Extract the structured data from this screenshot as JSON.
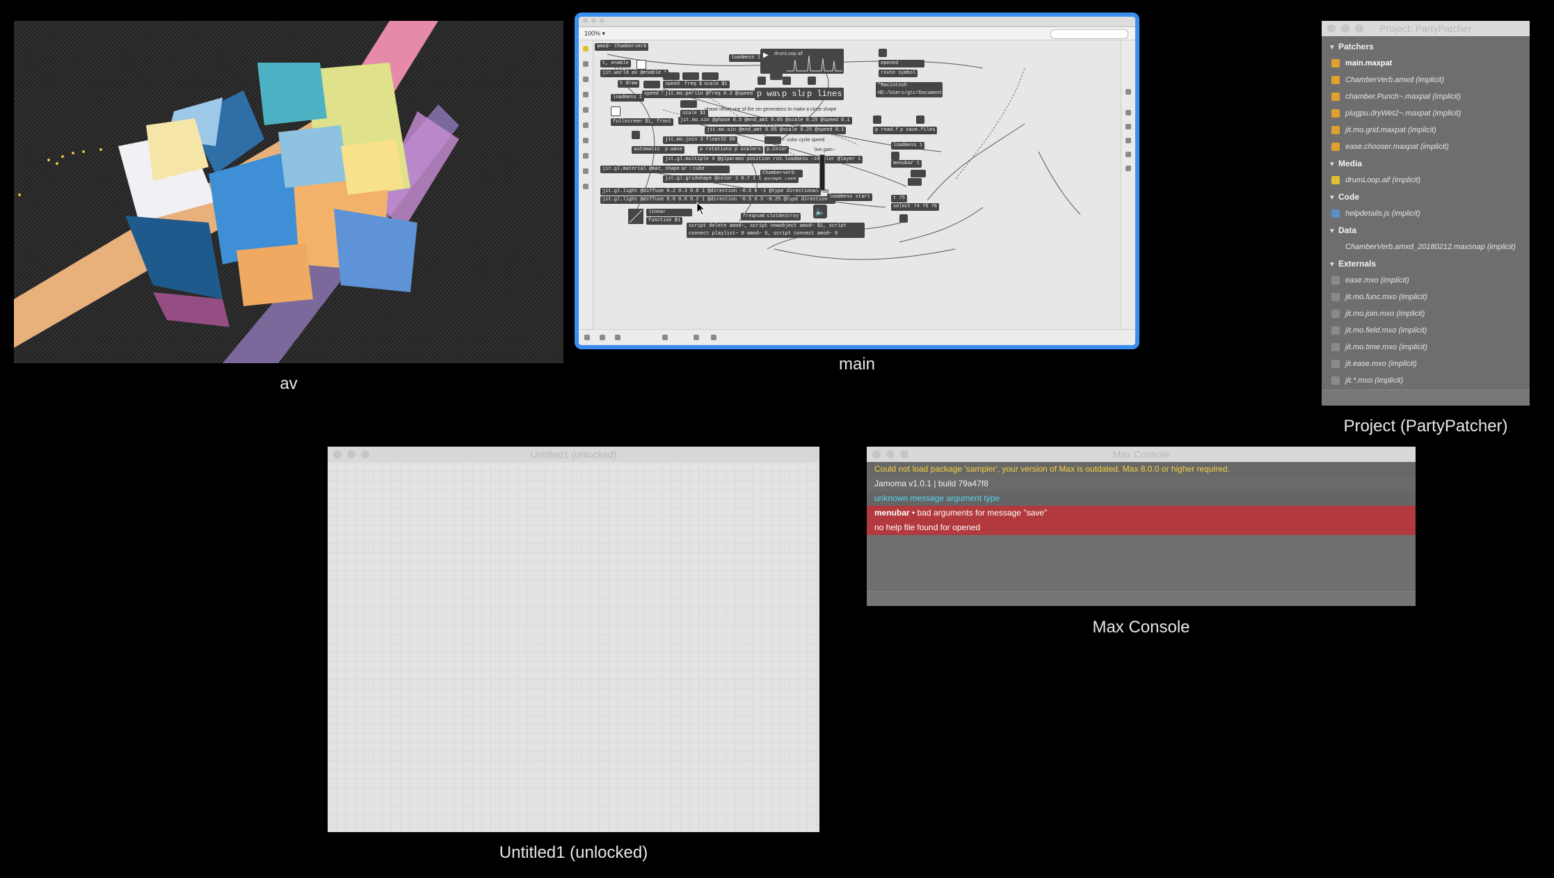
{
  "windows": {
    "av": {
      "caption": "av"
    },
    "main": {
      "caption": "main",
      "zoom": "100% ▾",
      "objects": {
        "amod": "amod~ Chamberverb",
        "enable": "t, enable",
        "toolbar_label": "loadmess 1",
        "drumloop": "drumLoop.aif",
        "jitworld": "jit.world av @enable 1",
        "draw": "t draw",
        "loadmess1": "loadmess 1",
        "fullscreen": "fullscreen $1, front",
        "automatic": "automatic $1",
        "perlin": "jit.mo.perlin @freq 0.3 @speed 0.01 @scale 0.75",
        "speed": "speed $1",
        "freq": "freq $1",
        "scale": "scale $1",
        "pwave": "p wave",
        "pslats": "p slats",
        "plines": "p lines",
        "phase_comment": "phase offset one of the sin generators to make a circle shape",
        "mosin1": "jit.mo.sin @phase 0.5 @end_amt 0.05 @scale 0.25 @speed 0.1",
        "mosin2": "jit.mo.sin @end_amt 0.05 @scale 0.25 @speed 0.1",
        "join": "jit.mo.join 3 float32 60",
        "pwave_small": "p.wave",
        "protations": "p rotations",
        "pscalers": "p scalers",
        "pcolor": "p.color",
        "color_comment": "<- color cycle speed",
        "multiple": "jit.gl.multiple 4 @glparams position rotatexyz scale color @layer 1",
        "loadmess24": "loadmess -24",
        "material": "jit.gl.material @mat_specular 0 0 0 0",
        "shape": "shape",
        "cube": "cube",
        "gridshape": "jit.gl.gridshape @color 1 0.7 1 1 @shape cube",
        "chamberverb": "Chamberverb",
        "live_gain": "live.gain~",
        "db": "-24 dB",
        "light1": "jit.gl.light @diffuse 0.2 0.3 0.8 1 @direction -0.5 0 -1 @type directional",
        "light2": "jit.gl.light @diffuse 0.8 0.8 0.2 1 @direction -0.5 0.3 -0.25 @type directional",
        "loadmess_start": "loadmess start",
        "linear": "linear",
        "function": "function $1",
        "freqnumber": "freqnumber",
        "slotdestroy": "slotdestroy",
        "script": "script delete amod~, script newobject amod~ $1, script connect playlist~ 0 amod~ 0, script connect amod~ 0 live.gain~ 0, script connect playlist~ 1 amod~ 1, amod~ 1 live.gain~ 1",
        "opened": "opened",
        "route_symbol": "route symbol",
        "path": "\"Macintosh HD:/Users/gtc/Documents/my party\"",
        "preadfiles": "p read.files",
        "psavefiles": "p save.files",
        "loadmess1b": "loadmess 1",
        "menubar": "menubar 1",
        "p75": "t 75",
        "select": "select 74 75 76"
      }
    },
    "project": {
      "title": "Project: PartyPatcher",
      "caption": "Project (PartyPatcher)",
      "sections": [
        {
          "name": "Patchers",
          "items": [
            {
              "label": "main.maxpat",
              "strong": true,
              "icon_color": "#e0a030"
            },
            {
              "label": "ChamberVerb.amxd (implicit)",
              "icon_color": "#e0a030"
            },
            {
              "label": "chamber.Punch~.maxpat (implicit)",
              "icon_color": "#e0a030"
            },
            {
              "label": "plugpu.dryWet2~.maxpat (implicit)",
              "icon_color": "#e0a030"
            },
            {
              "label": "jit.mo.grid.maxpat (implicit)",
              "icon_color": "#e0a030"
            },
            {
              "label": "ease.chooser.maxpat (implicit)",
              "icon_color": "#e0a030"
            }
          ]
        },
        {
          "name": "Media",
          "items": [
            {
              "label": "drumLoop.aif (implicit)",
              "icon_color": "#e0c030"
            }
          ]
        },
        {
          "name": "Code",
          "items": [
            {
              "label": "helpdetails.js (implicit)",
              "icon_color": "#5a8ec6"
            }
          ]
        },
        {
          "name": "Data",
          "items": [
            {
              "label": "ChamberVerb.amxd_20180212.maxsnap (implicit)",
              "icon_color": ""
            }
          ]
        },
        {
          "name": "Externals",
          "items": [
            {
              "label": "ease.mxo (implicit)",
              "icon_color": "#8a8a8a"
            },
            {
              "label": "jit.mo.func.mxo (implicit)",
              "icon_color": "#8a8a8a"
            },
            {
              "label": "jit.mo.join.mxo (implicit)",
              "icon_color": "#8a8a8a"
            },
            {
              "label": "jit.mo.field.mxo (implicit)",
              "icon_color": "#8a8a8a"
            },
            {
              "label": "jit.mo.time.mxo (implicit)",
              "icon_color": "#8a8a8a"
            },
            {
              "label": "jit.ease.mxo (implicit)",
              "icon_color": "#8a8a8a"
            },
            {
              "label": "jit.*.mxo (implicit)",
              "icon_color": "#8a8a8a"
            }
          ]
        }
      ]
    },
    "untitled": {
      "title": "Untitled1 (unlocked)",
      "caption": "Untitled1 (unlocked)"
    },
    "console": {
      "title": "Max Console",
      "caption": "Max Console",
      "messages": {
        "warn": "Could not load package 'sampler', your version of Max is outdated. Max 8.0.0 or higher required.",
        "jamoma": "Jamoma  v1.0.1  |  build 79a47f8",
        "cyan": "unknown message argument type",
        "err_source": "menubar",
        "err_text": "•  bad arguments for message \"save\"",
        "nohelp": "no help file found for opened"
      }
    }
  },
  "colors": {
    "selection_border": "#3b8ef0",
    "error_row": "#b2393d",
    "warning_text": "#f4d03f",
    "info_text": "#53d6f0"
  }
}
